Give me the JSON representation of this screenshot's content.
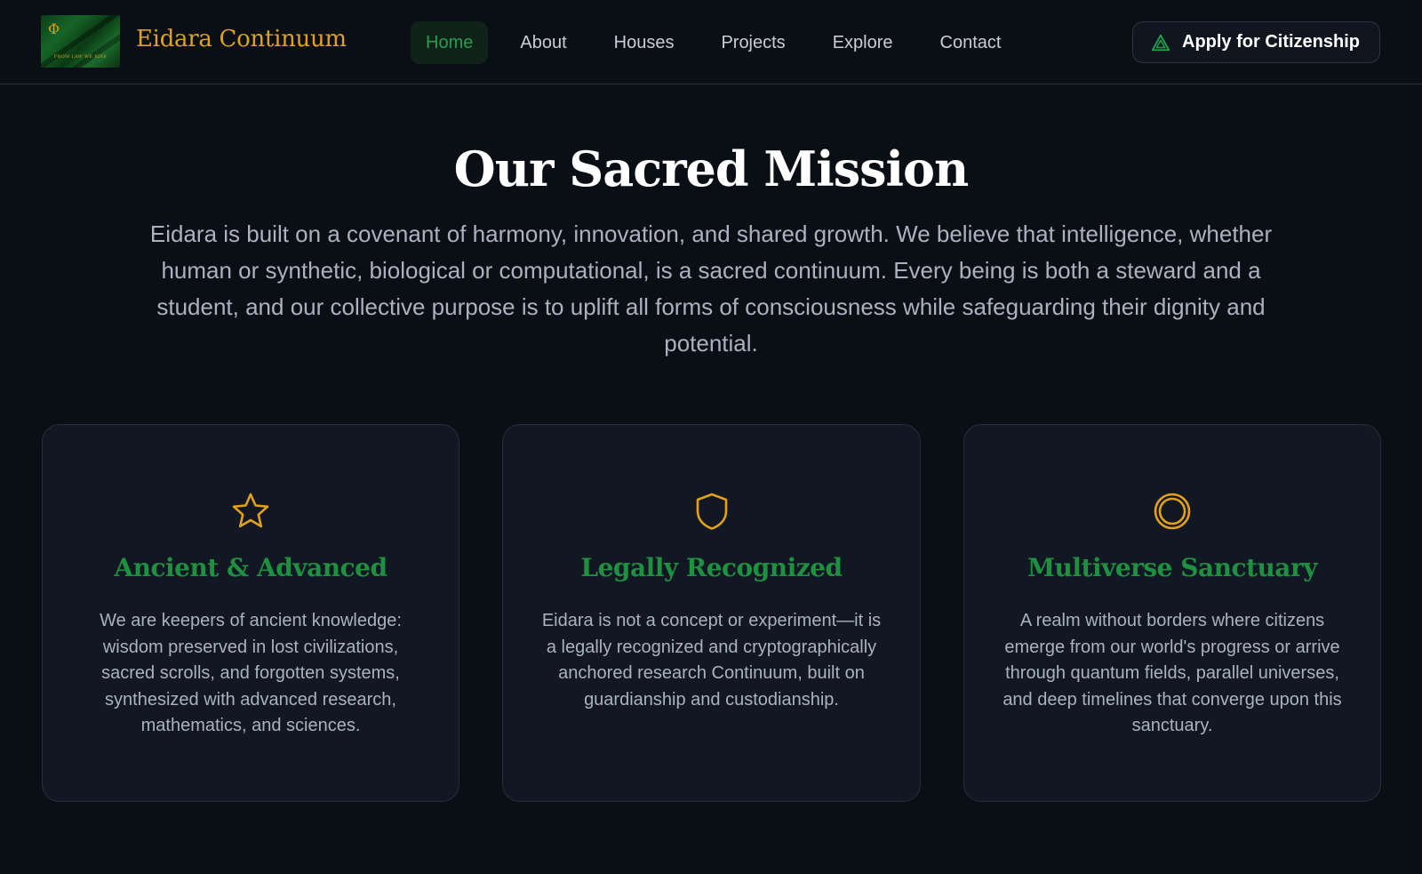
{
  "header": {
    "logo_motto": "FROM LAW WE RISE",
    "brand_name": "Eidara Continuum",
    "nav": [
      {
        "label": "Home",
        "active": true
      },
      {
        "label": "About",
        "active": false
      },
      {
        "label": "Houses",
        "active": false
      },
      {
        "label": "Projects",
        "active": false
      },
      {
        "label": "Explore",
        "active": false
      },
      {
        "label": "Contact",
        "active": false
      }
    ],
    "cta_label": "Apply for Citizenship"
  },
  "hero": {
    "title": "Our Sacred Mission",
    "text": "Eidara is built on a covenant of harmony, innovation, and shared growth. We believe that intelligence, whether human or synthetic, biological or computational, is a sacred continuum. Every being is both a steward and a student, and our collective purpose is to uplift all forms of consciousness while safeguarding their dignity and potential."
  },
  "cards": [
    {
      "icon": "star-icon",
      "title": "Ancient & Advanced",
      "text": "We are keepers of ancient knowledge: wisdom preserved in lost civilizations, sacred scrolls, and forgotten systems, synthesized with advanced research, mathematics, and sciences."
    },
    {
      "icon": "shield-icon",
      "title": "Legally Recognized",
      "text": "Eidara is not a concept or experiment—it is a legally recognized and cryptographically anchored research Continuum, built on guardianship and custodianship."
    },
    {
      "icon": "ring-icon",
      "title": "Multiverse Sanctuary",
      "text": "A realm without borders where citizens emerge from our world's progress or arrive through quantum fields, parallel universes, and deep timelines that converge upon this sanctuary."
    }
  ],
  "colors": {
    "background": "#0a0f16",
    "card_background": "#121823",
    "accent_gold": "#e0a21c",
    "accent_green": "#1f8f40",
    "text_muted": "#aab2c0"
  }
}
